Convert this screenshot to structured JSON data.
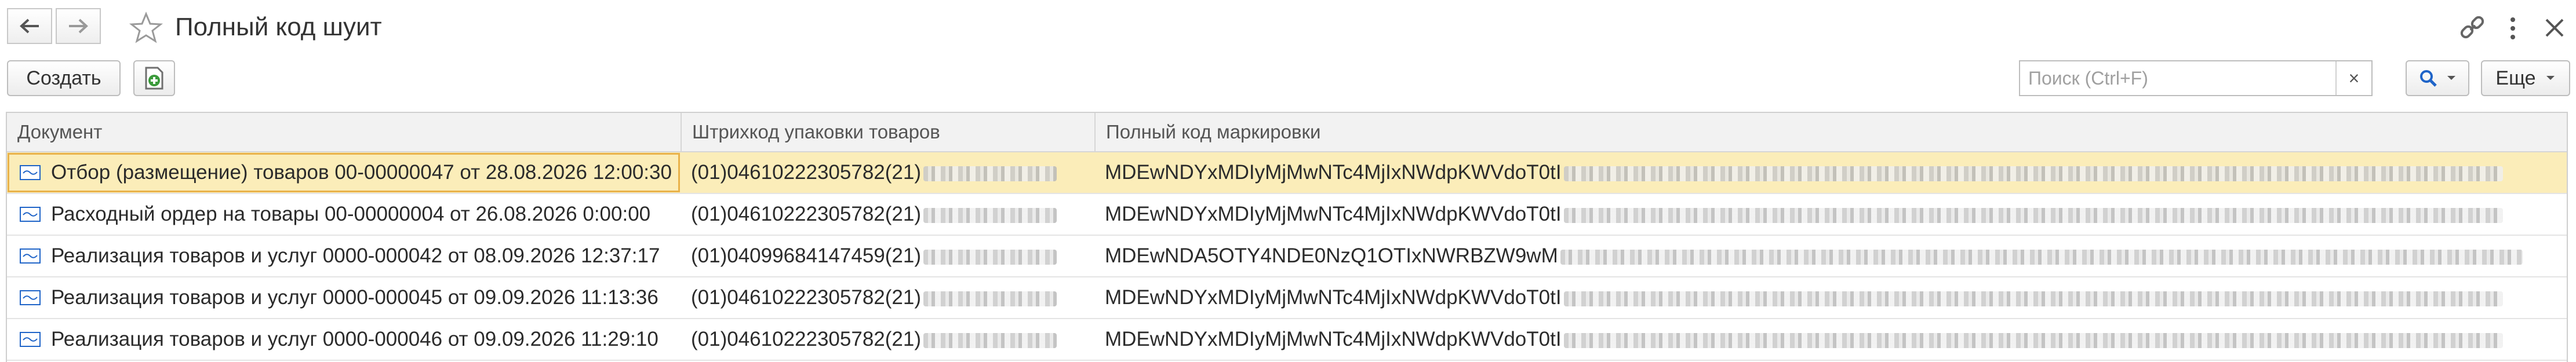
{
  "window": {
    "title": "Полный код шуит"
  },
  "toolbar": {
    "create_label": "Создать",
    "more_label": "Еще",
    "search_placeholder": "Поиск (Ctrl+F)",
    "clear_symbol": "×"
  },
  "table": {
    "columns": [
      "Документ",
      "Штрихкод упаковки товаров",
      "Полный код маркировки"
    ],
    "rows": [
      {
        "document": "Отбор (размещение) товаров 00-00000047 от 28.08.2026 12:00:30",
        "barcode": "(01)04610222305782(21)",
        "marking_code": "MDEwNDYxMDIyMjMwNTc4MjIxNWdpKWVdoT0tI",
        "selected": true
      },
      {
        "document": "Расходный ордер на товары 00-00000004 от 26.08.2026 0:00:00",
        "barcode": "(01)04610222305782(21)",
        "marking_code": "MDEwNDYxMDIyMjMwNTc4MjIxNWdpKWVdoT0tI",
        "selected": false
      },
      {
        "document": "Реализация товаров и услуг 0000-000042 от 08.09.2026 12:37:17",
        "barcode": "(01)04099684147459(21)",
        "marking_code": "MDEwNDA5OTY4NDE0NzQ1OTIxNWRBZW9wM",
        "selected": false
      },
      {
        "document": "Реализация товаров и услуг 0000-000045 от 09.09.2026 11:13:36",
        "barcode": "(01)04610222305782(21)",
        "marking_code": "MDEwNDYxMDIyMjMwNTc4MjIxNWdpKWVdoT0tI",
        "selected": false
      },
      {
        "document": "Реализация товаров и услуг 0000-000046 от 09.09.2026 11:29:10",
        "barcode": "(01)04610222305782(21)",
        "marking_code": "MDEwNDYxMDIyMjMwNTc4MjIxNWdpKWVdoT0tI",
        "selected": false
      }
    ]
  },
  "icons": {
    "back": "arrow-left-icon",
    "forward": "arrow-right-icon",
    "favorite": "star-icon",
    "link": "link-icon",
    "menu": "more-vertical-icon",
    "close": "close-icon",
    "create_from": "add-document-icon",
    "search": "search-icon",
    "document_row": "document-icon"
  },
  "colors": {
    "selected_row": "#fbedb9",
    "header_bg": "#f2f2f2",
    "accent_blue": "#1f64c8",
    "add_icon_green": "#3a9a3a"
  }
}
